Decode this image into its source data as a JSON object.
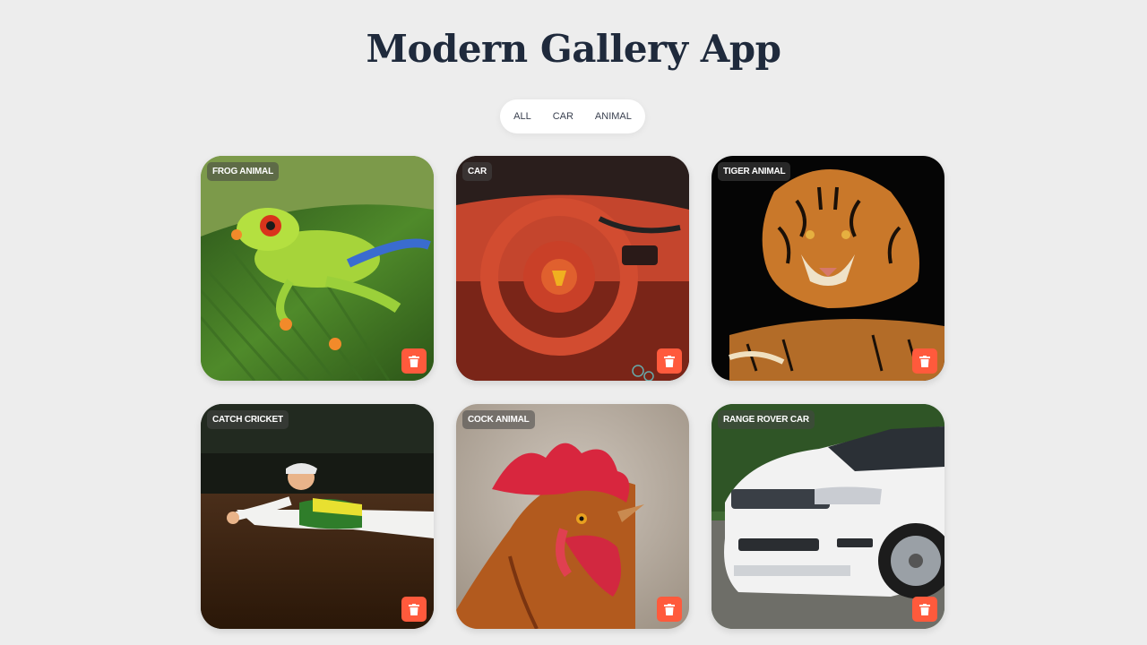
{
  "app": {
    "title": "Modern Gallery App"
  },
  "filters": [
    {
      "label": "ALL"
    },
    {
      "label": "CAR"
    },
    {
      "label": "ANIMAL"
    }
  ],
  "cards": [
    {
      "label": "FROG ANIMAL",
      "image": "frog-image"
    },
    {
      "label": "CAR",
      "image": "car-interior-image"
    },
    {
      "label": "TIGER ANIMAL",
      "image": "tiger-image"
    },
    {
      "label": "CATCH CRICKET",
      "image": "cricket-catch-image"
    },
    {
      "label": "COCK ANIMAL",
      "image": "rooster-image"
    },
    {
      "label": "RANGE ROVER CAR",
      "image": "range-rover-image"
    }
  ],
  "colors": {
    "background": "#ededed",
    "title": "#1f2a3c",
    "delete_button": "#ff5a3c",
    "label_bg": "rgba(70,70,70,0.55)"
  },
  "icons": {
    "delete": "trash-icon"
  }
}
